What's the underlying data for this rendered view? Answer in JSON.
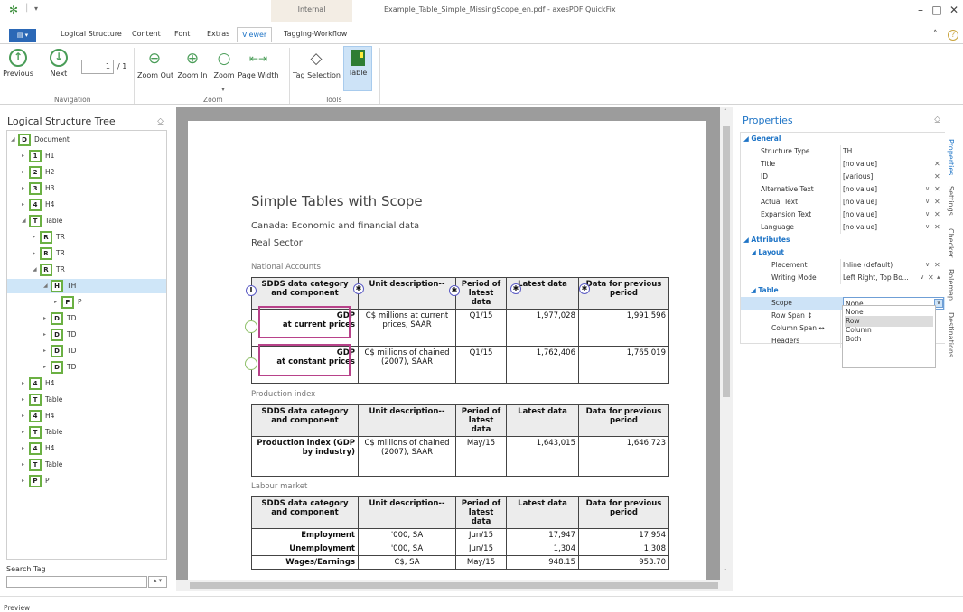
{
  "titlebar": {
    "title": "Example_Table_Simple_MissingScope_en.pdf - axesPDF QuickFix",
    "context_tab": "Internal",
    "quick_access": "▾",
    "minimize": "–",
    "maximize": "□",
    "close": "✕"
  },
  "tabs": {
    "file": "▤ ▾",
    "logical_structure": "Logical Structure",
    "content": "Content",
    "font": "Font",
    "extras": "Extras",
    "viewer": "Viewer",
    "tagging_workflow": "Tagging-Workflow",
    "collapse": "˄",
    "help": "?"
  },
  "ribbon": {
    "previous": "Previous",
    "next": "Next",
    "page_value": "1",
    "page_total": "/ 1",
    "zoom_out": "Zoom Out",
    "zoom_in": "Zoom In",
    "zoom": "Zoom",
    "page_width": "Page Width",
    "tag_selection": "Tag Selection",
    "table": "Table",
    "group_navigation": "Navigation",
    "group_zoom": "Zoom",
    "group_tools": "Tools"
  },
  "left_panel": {
    "title": "Logical Structure Tree",
    "pin": "⎐",
    "search_label": "Search Tag",
    "search_arrows": "▴ ▾",
    "nodes": [
      {
        "label": "Document",
        "icon": "D"
      },
      {
        "label": "H1",
        "icon": "1"
      },
      {
        "label": "H2",
        "icon": "2"
      },
      {
        "label": "H3",
        "icon": "3"
      },
      {
        "label": "H4",
        "icon": "4"
      },
      {
        "label": "Table",
        "icon": "T"
      },
      {
        "label": "TR",
        "icon": "R"
      },
      {
        "label": "TR",
        "icon": "R"
      },
      {
        "label": "TR",
        "icon": "R"
      },
      {
        "label": "TH",
        "icon": "H"
      },
      {
        "label": "P",
        "icon": "P"
      },
      {
        "label": "TD",
        "icon": "D"
      },
      {
        "label": "TD",
        "icon": "D"
      },
      {
        "label": "TD",
        "icon": "D"
      },
      {
        "label": "TD",
        "icon": "D"
      },
      {
        "label": "H4",
        "icon": "4"
      },
      {
        "label": "Table",
        "icon": "T"
      },
      {
        "label": "H4",
        "icon": "4"
      },
      {
        "label": "Table",
        "icon": "T"
      },
      {
        "label": "H4",
        "icon": "4"
      },
      {
        "label": "Table",
        "icon": "T"
      },
      {
        "label": "P",
        "icon": "P"
      }
    ]
  },
  "document": {
    "title": "Simple Tables with Scope",
    "subtitle": "Canada: Economic and financial data",
    "real_sector": "Real Sector",
    "section1": "National Accounts",
    "section2": "Production index",
    "section3": "Labour market",
    "headers": {
      "h1": "SDDS data category and component",
      "h2": "Unit description--",
      "h3": "Period of latest data",
      "h4": "Latest data",
      "h5": "Data for previous period"
    },
    "national_accounts": [
      {
        "c1a": "GDP",
        "c1b": "at current prices",
        "c2": "C$ millions at current prices, SAAR",
        "c3": "Q1/15",
        "c4": "1,977,028",
        "c5": "1,991,596"
      },
      {
        "c1a": "GDP",
        "c1b": "at constant prices",
        "c2": "C$ millions of chained (2007), SAAR",
        "c3": "Q1/15",
        "c4": "1,762,406",
        "c5": "1,765,019"
      }
    ],
    "production": [
      {
        "c1": "Production index (GDP by industry)",
        "c2": "C$ millions of chained (2007), SAAR",
        "c3": "May/15",
        "c4": "1,643,015",
        "c5": "1,646,723"
      }
    ],
    "labour": [
      {
        "c1": "Employment",
        "c2": "'000, SA",
        "c3": "Jun/15",
        "c4": "17,947",
        "c5": "17,954"
      },
      {
        "c1": "Unemployment",
        "c2": "'000, SA",
        "c3": "Jun/15",
        "c4": "1,304",
        "c5": "1,308"
      },
      {
        "c1": "Wages/Earnings",
        "c2": "C$, SA",
        "c3": "May/15",
        "c4": "948.15",
        "c5": "953.70"
      }
    ]
  },
  "properties": {
    "title": "Properties",
    "pin": "⎐",
    "general": "General",
    "structure_type_k": "Structure Type",
    "structure_type_v": "TH",
    "title_k": "Title",
    "title_v": "[no value]",
    "id_k": "ID",
    "id_v": "[various]",
    "alt_k": "Alternative Text",
    "alt_v": "[no value]",
    "actual_k": "Actual Text",
    "actual_v": "[no value]",
    "expansion_k": "Expansion Text",
    "expansion_v": "[no value]",
    "language_k": "Language",
    "language_v": "[no value]",
    "attributes": "Attributes",
    "layout": "Layout",
    "placement_k": "Placement",
    "placement_v": "Inline (default)",
    "writing_k": "Writing Mode",
    "writing_v": "Left Right, Top Bo...",
    "table": "Table",
    "scope_k": "Scope",
    "scope_v": "None",
    "rowspan_k": "Row Span ↕",
    "colspan_k": "Column Span ↔",
    "headers_k": "Headers",
    "scope_options": [
      "None",
      "Row",
      "Column",
      "Both"
    ]
  },
  "side_tabs": [
    "Properties",
    "Settings",
    "Checker",
    "Rolemap",
    "Destinations"
  ],
  "status": "Preview"
}
